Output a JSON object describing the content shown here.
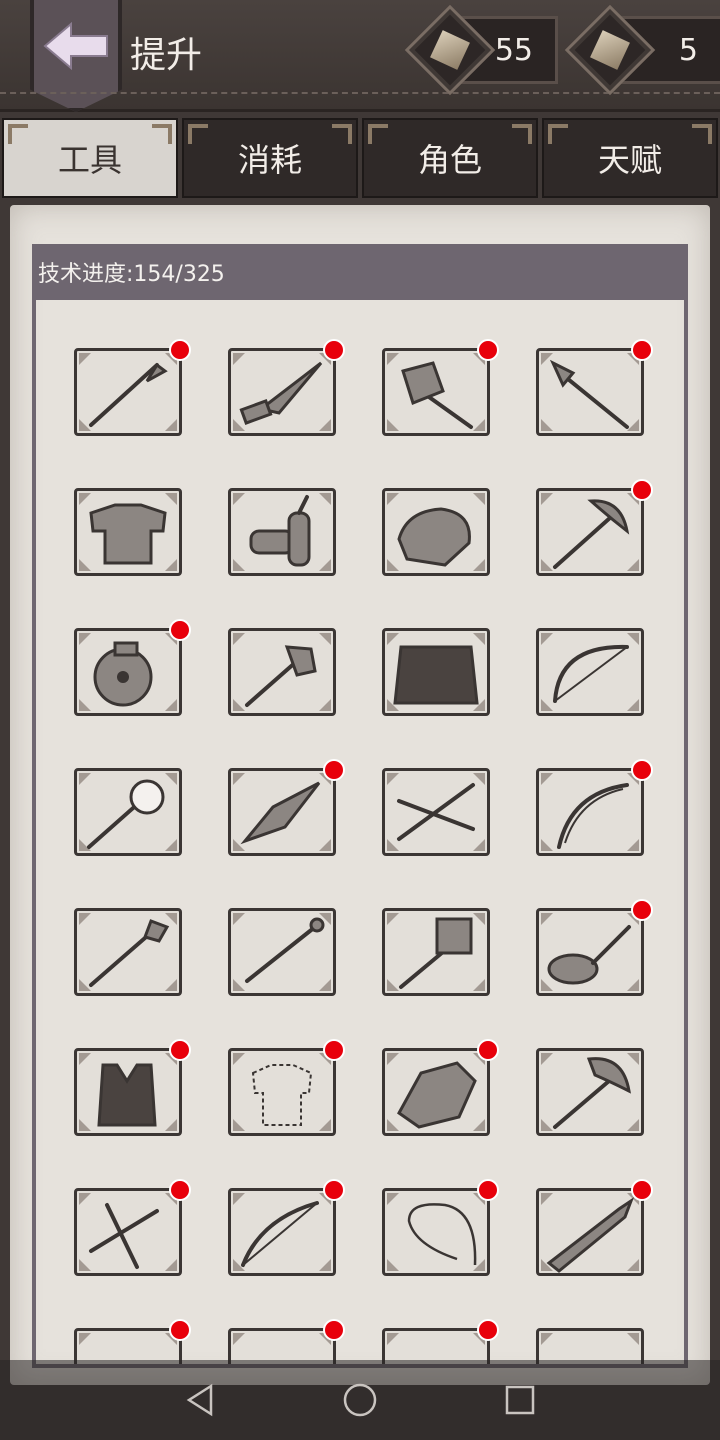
{
  "header": {
    "title": "提升",
    "back_icon": "back-arrow-icon",
    "resources": [
      {
        "icon": "leather-scroll-icon",
        "value": "55"
      },
      {
        "icon": "parchment-icon",
        "value": "5"
      }
    ]
  },
  "tabs": [
    {
      "label": "工具",
      "active": true
    },
    {
      "label": "消耗",
      "active": false
    },
    {
      "label": "角色",
      "active": false
    },
    {
      "label": "天赋",
      "active": false
    }
  ],
  "progress": {
    "label": "技术进度:154/325"
  },
  "items": [
    {
      "icon": "spear-icon",
      "dot": true
    },
    {
      "icon": "knife-icon",
      "dot": true
    },
    {
      "icon": "stone-hammer-icon",
      "dot": true
    },
    {
      "icon": "harpoon-icon",
      "dot": true
    },
    {
      "icon": "chainmail-armor-icon",
      "dot": false
    },
    {
      "icon": "dynamite-icon",
      "dot": false
    },
    {
      "icon": "backpack-icon",
      "dot": false
    },
    {
      "icon": "double-axe-icon",
      "dot": true
    },
    {
      "icon": "poison-jar-icon",
      "dot": true
    },
    {
      "icon": "stone-axe-icon",
      "dot": false
    },
    {
      "icon": "grass-skirt-icon",
      "dot": false
    },
    {
      "icon": "bow-icon",
      "dot": false
    },
    {
      "icon": "torch-icon",
      "dot": false
    },
    {
      "icon": "stone-blade-icon",
      "dot": true
    },
    {
      "icon": "arrows-icon",
      "dot": false
    },
    {
      "icon": "longbow-icon",
      "dot": true
    },
    {
      "icon": "tribal-spear-icon",
      "dot": false
    },
    {
      "icon": "staff-icon",
      "dot": false
    },
    {
      "icon": "war-hammer-icon",
      "dot": false
    },
    {
      "icon": "frying-pan-icon",
      "dot": true
    },
    {
      "icon": "leather-vest-icon",
      "dot": true
    },
    {
      "icon": "unknown-shirt-icon",
      "dot": true
    },
    {
      "icon": "flint-stone-icon",
      "dot": true
    },
    {
      "icon": "battle-axe-icon",
      "dot": false
    },
    {
      "icon": "crossbow-icon",
      "dot": true
    },
    {
      "icon": "compound-bow-icon",
      "dot": true
    },
    {
      "icon": "whip-icon",
      "dot": true
    },
    {
      "icon": "great-sword-icon",
      "dot": true
    },
    {
      "icon": "hidden-item-icon",
      "dot": true
    },
    {
      "icon": "hidden-item-icon",
      "dot": true
    },
    {
      "icon": "hidden-item-icon",
      "dot": true
    },
    {
      "icon": "hidden-item-icon",
      "dot": false
    }
  ],
  "navbar": {
    "back_icon": "nav-back-icon",
    "home_icon": "nav-home-icon",
    "recents_icon": "nav-recents-icon"
  },
  "colors": {
    "badge": "#e8000b",
    "header_bg": "#3f3836",
    "paper": "#e6e2dc",
    "progress_bar": "#6e6670"
  }
}
